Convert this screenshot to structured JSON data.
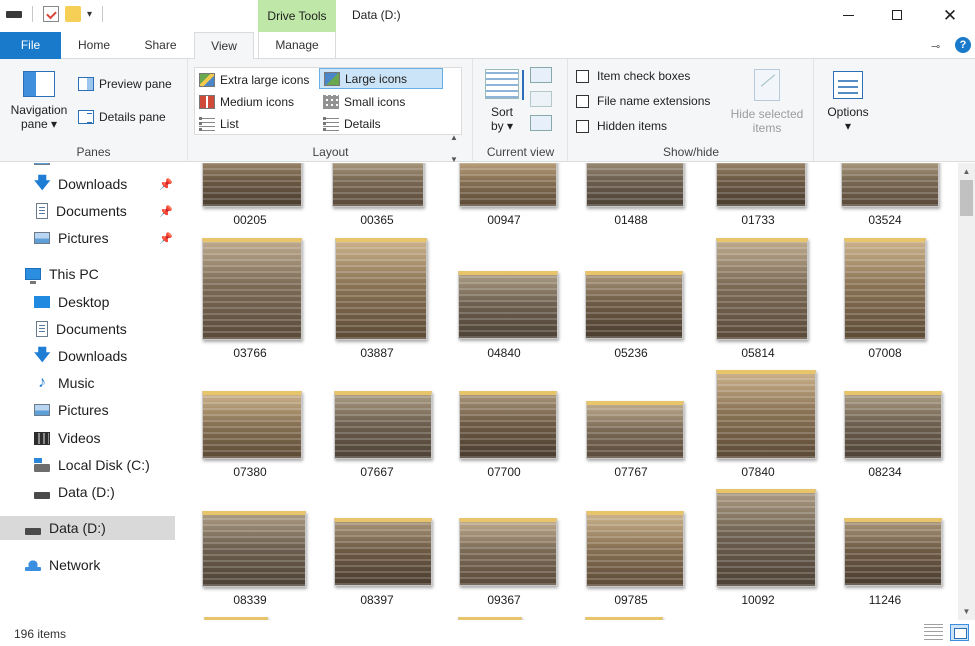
{
  "window": {
    "title": "Data (D:)",
    "context_tab": "Drive Tools"
  },
  "tabs": {
    "file": "File",
    "home": "Home",
    "share": "Share",
    "view": "View",
    "manage": "Manage"
  },
  "ribbon": {
    "panes": {
      "navigation_pane": "Navigation",
      "navigation_pane_2": "pane ▾",
      "preview_pane": "Preview pane",
      "details_pane": "Details pane",
      "label": "Panes"
    },
    "layout": {
      "items": [
        "Extra large icons",
        "Large icons",
        "Medium icons",
        "Small icons",
        "List",
        "Details"
      ],
      "selected": "Large icons",
      "label": "Layout"
    },
    "current_view": {
      "sort_by": "Sort",
      "sort_by_2": "by ▾",
      "label": "Current view"
    },
    "show_hide": {
      "item_check_boxes": "Item check boxes",
      "file_name_extensions": "File name extensions",
      "hidden_items": "Hidden items",
      "hide_selected": "Hide selected",
      "hide_selected_2": "items",
      "label": "Show/hide"
    },
    "options": {
      "label": "Options",
      "arrow": "▾"
    }
  },
  "nav": {
    "quick_access": [
      {
        "label": "Downloads",
        "icon": "download-icon",
        "pinned": true
      },
      {
        "label": "Documents",
        "icon": "documents-icon",
        "pinned": true
      },
      {
        "label": "Pictures",
        "icon": "pictures-icon",
        "pinned": true
      }
    ],
    "this_pc": "This PC",
    "this_pc_items": [
      {
        "label": "Desktop",
        "icon": "desktop-icon"
      },
      {
        "label": "Documents",
        "icon": "documents-icon"
      },
      {
        "label": "Downloads",
        "icon": "download-icon"
      },
      {
        "label": "Music",
        "icon": "music-icon"
      },
      {
        "label": "Pictures",
        "icon": "pictures-icon"
      },
      {
        "label": "Videos",
        "icon": "videos-icon"
      },
      {
        "label": "Local Disk (C:)",
        "icon": "local-disk-icon"
      },
      {
        "label": "Data (D:)",
        "icon": "drive-icon"
      }
    ],
    "data_d": "Data (D:)",
    "network": "Network"
  },
  "files": [
    [
      "00205",
      "00365",
      "00947",
      "01488",
      "01733",
      "03524"
    ],
    [
      "03766",
      "03887",
      "04840",
      "05236",
      "05814",
      "07008"
    ],
    [
      "07380",
      "07667",
      "07700",
      "07767",
      "07840",
      "08234"
    ],
    [
      "08339",
      "08397",
      "09367",
      "09785",
      "10092",
      "11246"
    ]
  ],
  "status": {
    "item_count": "196 items"
  },
  "colors": {
    "accent": "#1979ca",
    "drive_tools": "#bfe8a8",
    "selected_bg": "#cce4f7"
  }
}
